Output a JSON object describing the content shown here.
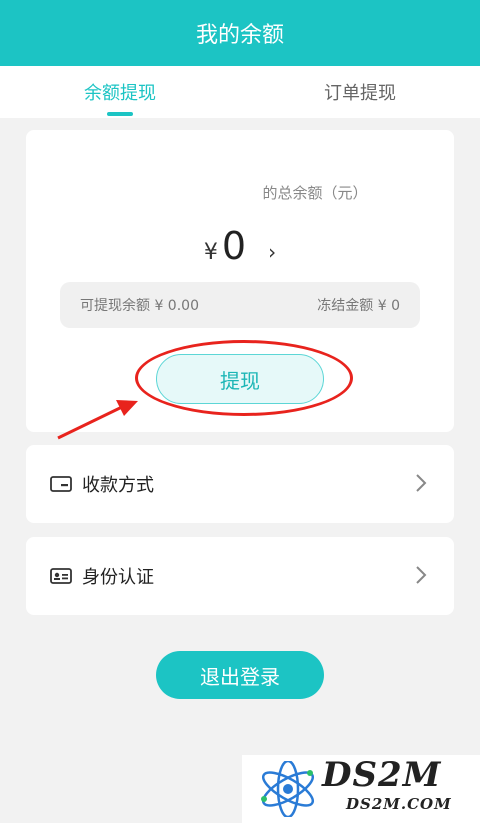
{
  "header": {
    "title": "我的余额"
  },
  "tabs": [
    {
      "label": "余额提现",
      "active": true
    },
    {
      "label": "订单提现",
      "active": false
    }
  ],
  "balance": {
    "total_label": "的总余额（元）",
    "currency": "¥",
    "amount": "0",
    "arrow": "›",
    "withdrawable_label": "可提现余额 ¥ 0.00",
    "frozen_label": "冻结金额 ¥ 0"
  },
  "withdraw_button": "提现",
  "menu": {
    "payment_method": "收款方式",
    "identity_verification": "身份认证"
  },
  "logout_button": "退出登录",
  "watermark": {
    "main": "DS2M",
    "sub": "DS2M.COM"
  },
  "colors": {
    "accent": "#1cc4c4",
    "annotation": "#e8231d"
  }
}
